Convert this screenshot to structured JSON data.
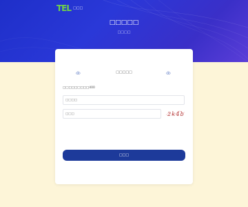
{
  "header": {
    "logo_mark": "TEL",
    "logo_text": "□□□",
    "title": "□□□□□",
    "subtitle": "□□□□"
  },
  "login": {
    "tab_label": "□□□□□",
    "hint": "□□□□□□□□□400",
    "phone_placeholder": "□□□□",
    "code_placeholder": "□□□",
    "captcha_text": "2k4b",
    "submit_label": "□□□"
  },
  "colors": {
    "brand": "#1d3a9a",
    "hero": "#1e2fc9",
    "logo": "#6fd14a",
    "background": "#fdf5d8"
  },
  "icons": {
    "left_tab": "cloud-user-icon",
    "right_tab": "cloud-user-icon"
  }
}
